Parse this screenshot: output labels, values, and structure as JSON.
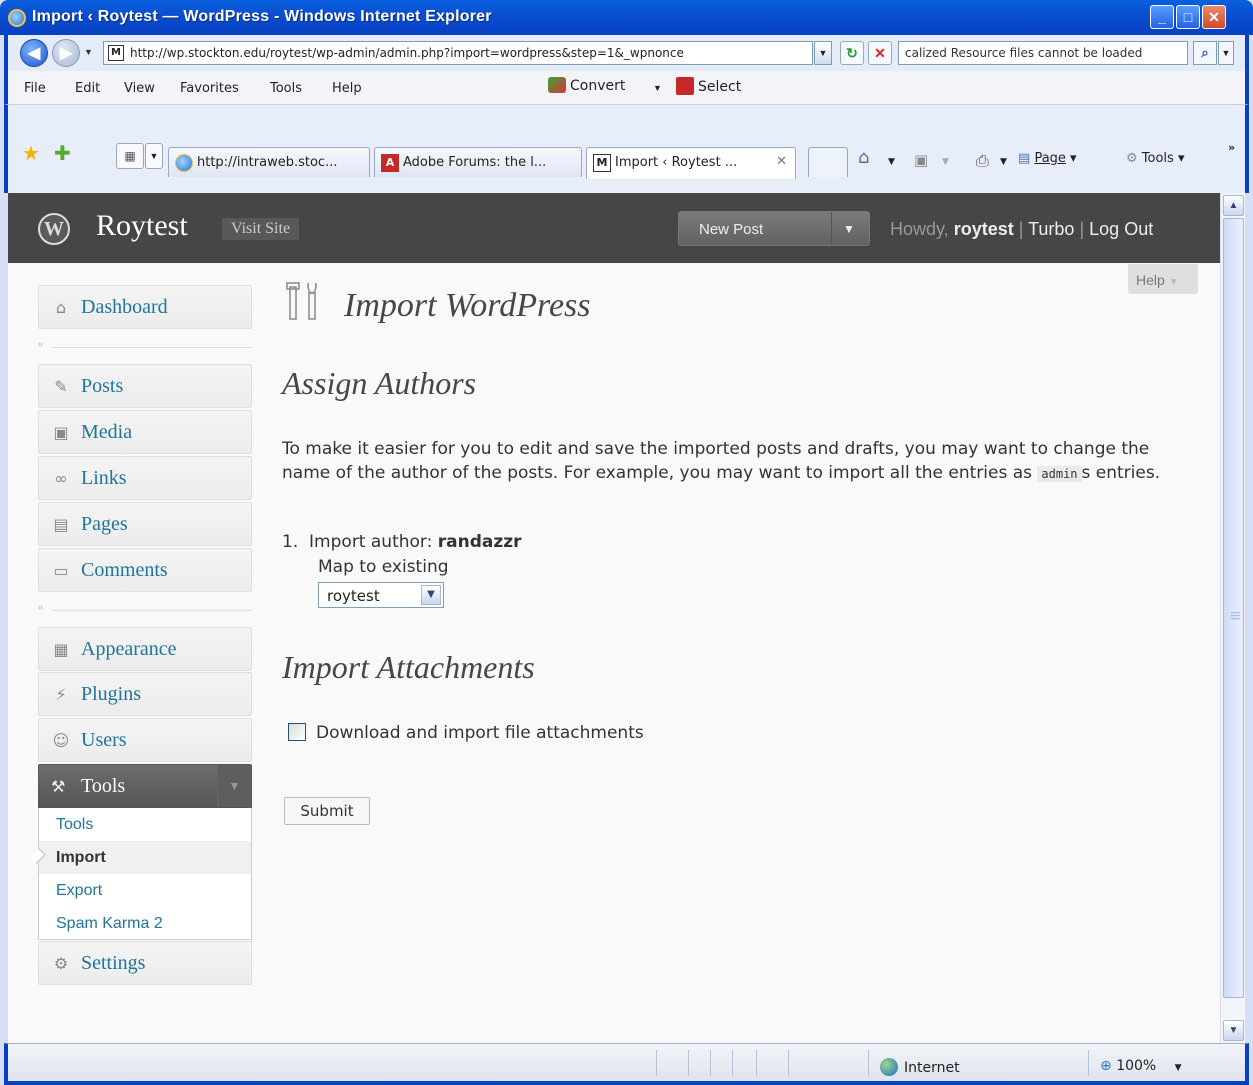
{
  "window": {
    "title": "Import ‹ Roytest — WordPress - Windows Internet Explorer",
    "minimize": "_",
    "maximize": "□",
    "close": "✕"
  },
  "address": {
    "url": "http://wp.stockton.edu/roytest/wp-admin/admin.php?import=wordpress&step=1&_wpnonce",
    "search_value": "calized Resource files cannot be loaded"
  },
  "menubar": {
    "items": [
      "File",
      "Edit",
      "View",
      "Favorites",
      "Tools",
      "Help"
    ],
    "convert_label": "Convert",
    "select_label": "Select"
  },
  "tabs": [
    {
      "label": "http://intraweb.stoc..."
    },
    {
      "label": "Adobe Forums: the l..."
    },
    {
      "label": "Import ‹ Roytest ..."
    }
  ],
  "commandbar": {
    "page_label": "Page",
    "tools_label": "Tools"
  },
  "wp": {
    "site_title": "Roytest",
    "visit_site": "Visit Site",
    "new_post": "New Post",
    "howdy_prefix": "Howdy, ",
    "username": "roytest",
    "turbo": "Turbo",
    "logout": "Log Out",
    "help": "Help"
  },
  "sidebar": {
    "items": [
      {
        "label": "Dashboard",
        "icon": "home-icon"
      },
      {
        "label": "Posts",
        "icon": "pin-icon"
      },
      {
        "label": "Media",
        "icon": "media-icon"
      },
      {
        "label": "Links",
        "icon": "link-icon"
      },
      {
        "label": "Pages",
        "icon": "page-icon"
      },
      {
        "label": "Comments",
        "icon": "comment-icon"
      },
      {
        "label": "Appearance",
        "icon": "appearance-icon"
      },
      {
        "label": "Plugins",
        "icon": "plugin-icon"
      },
      {
        "label": "Users",
        "icon": "users-icon"
      },
      {
        "label": "Settings",
        "icon": "settings-icon"
      }
    ],
    "tools": {
      "label": "Tools",
      "submenu": [
        "Tools",
        "Import",
        "Export",
        "Spam Karma 2"
      ]
    }
  },
  "main": {
    "page_title": "Import WordPress",
    "assign_heading": "Assign Authors",
    "intro_before": "To make it easier for you to edit and save the imported posts and drafts, you may want to change the name of the author of the posts. For example, you may want to import all the entries as ",
    "intro_code": "admin",
    "intro_after": "s entries.",
    "author_number": "1.",
    "import_author_label": "Import author: ",
    "import_author_name": "randazzr",
    "map_label": "Map to existing",
    "map_selected": "roytest",
    "attachments_heading": "Import Attachments",
    "attachments_checkbox": "Download and import file attachments",
    "submit": "Submit"
  },
  "statusbar": {
    "zone": "Internet",
    "zoom": "100%"
  },
  "colors": {
    "accent": "#21759b",
    "header_bg": "#464646",
    "xp_blue": "#0641c2"
  }
}
